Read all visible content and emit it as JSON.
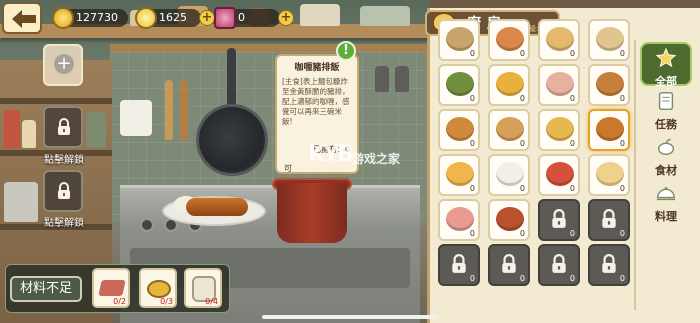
{
  "resources": {
    "coins": "127730",
    "gems": "1625",
    "tickets": "0"
  },
  "left_slots": {
    "unlock_label_1": "點擊解鎖",
    "unlock_label_2": "點擊解鎖"
  },
  "recipe_tooltip": {
    "title": "咖喱豬排飯",
    "description": "[主食]表上麵包糠炸至金黃酥脆的豬排，配上濃郁的咖喱，感覺可以再來三碗米飯!",
    "owned_label": "已擁有：0",
    "partial_label": "可"
  },
  "materials": {
    "label": "材料不足",
    "items": [
      {
        "name": "brick-ingredient",
        "count": "0/2"
      },
      {
        "name": "curry-ingredient",
        "count": "0/3"
      },
      {
        "name": "rice-ingredient",
        "count": "0/4"
      }
    ]
  },
  "kitchen_panel": {
    "title": "廚房",
    "level": "等級: 3"
  },
  "recipes": [
    {
      "icon": "dish-icon",
      "count": "0",
      "locked": false,
      "color": "#c9a56b"
    },
    {
      "icon": "dish-icon",
      "count": "0",
      "locked": false,
      "color": "#d9884a"
    },
    {
      "icon": "dish-icon",
      "count": "0",
      "locked": false,
      "color": "#e2b96d"
    },
    {
      "icon": "dish-icon",
      "count": "0",
      "locked": false,
      "color": "#e0c68e"
    },
    {
      "icon": "sushi-roll-icon",
      "count": "0",
      "locked": false,
      "color": "#6f8f3c"
    },
    {
      "icon": "omelette-rice-icon",
      "count": "0",
      "locked": false,
      "color": "#e9b13c"
    },
    {
      "icon": "cupcake-plate-icon",
      "count": "0",
      "locked": false,
      "color": "#e7b1a0"
    },
    {
      "icon": "baguette-icon",
      "count": "0",
      "locked": false,
      "color": "#c7803a"
    },
    {
      "icon": "fried-plate-icon",
      "count": "0",
      "locked": false,
      "color": "#d08a3b"
    },
    {
      "icon": "noodle-plate-icon",
      "count": "0",
      "locked": false,
      "color": "#d6a05a"
    },
    {
      "icon": "sandwich-icon",
      "count": "0",
      "locked": false,
      "color": "#e4b94d"
    },
    {
      "icon": "curry-cutlet-icon",
      "count": "0",
      "locked": false,
      "color": "#c9782c",
      "selected": true
    },
    {
      "icon": "bread-icon",
      "count": "0",
      "locked": false,
      "color": "#f0b64c"
    },
    {
      "icon": "onigiri-icon",
      "count": "0",
      "locked": false,
      "color": "#f3efe4"
    },
    {
      "icon": "cocktail-icon",
      "count": "0",
      "locked": false,
      "color": "#d7503d"
    },
    {
      "icon": "dumpling-plate-icon",
      "count": "0",
      "locked": false,
      "color": "#eed28b"
    },
    {
      "icon": "ham-icon",
      "count": "0",
      "locked": false,
      "color": "#e79c8f"
    },
    {
      "icon": "steak-plate-icon",
      "count": "0",
      "locked": false,
      "color": "#b8512c"
    },
    {
      "icon": "lock-icon",
      "count": "0",
      "locked": true
    },
    {
      "icon": "lock-icon",
      "count": "0",
      "locked": true
    },
    {
      "icon": "lock-icon",
      "count": "0",
      "locked": true
    },
    {
      "icon": "lock-icon",
      "count": "0",
      "locked": true
    },
    {
      "icon": "lock-icon",
      "count": "0",
      "locked": true
    },
    {
      "icon": "lock-icon",
      "count": "0",
      "locked": true
    }
  ],
  "side_tabs": {
    "all": "全部",
    "task": "任務",
    "ingredient": "食材",
    "cuisine": "料理"
  },
  "watermark": {
    "logo": "KYB",
    "site": "游戏之家"
  }
}
